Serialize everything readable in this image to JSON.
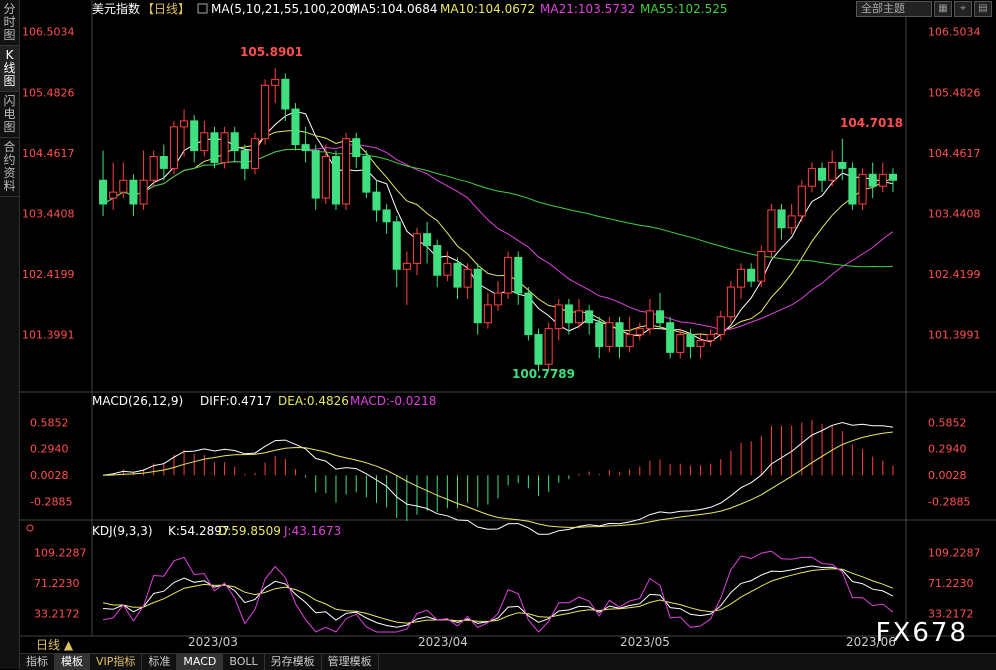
{
  "sidebar": {
    "items": [
      {
        "label": "分时图",
        "active": false
      },
      {
        "label": "K线图",
        "active": true
      },
      {
        "label": "闪电图",
        "active": false
      },
      {
        "label": "合约资料",
        "active": false
      }
    ]
  },
  "header": {
    "symbol": "美元指数",
    "period": "【日线】",
    "ma_title": "MA(5,10,21,55,100,200)",
    "ma5": "MA5:104.0684",
    "ma10": "MA10:104.0672",
    "ma21": "MA21:103.5732",
    "ma55": "MA55:102.525",
    "theme_select": "全部主题"
  },
  "price_axis": {
    "ticks": [
      "106.5034",
      "105.4826",
      "104.4617",
      "103.4408",
      "102.4199",
      "101.3991"
    ],
    "high_label": "105.8901",
    "low_label": "100.7789",
    "recent_high_label": "104.7018"
  },
  "macd": {
    "title": "MACD(26,12,9)",
    "diff": "DIFF:0.4717",
    "dea": "DEA:0.4826",
    "macd": "MACD:-0.0218",
    "ticks": [
      "0.5852",
      "0.2940",
      "0.0028",
      "-0.2885"
    ]
  },
  "kdj": {
    "title": "KDJ(9,3,3)",
    "k": "K:54.2897",
    "d": "D:59.8509",
    "j": "J:43.1673",
    "ticks": [
      "109.2287",
      "71.2230",
      "33.2172"
    ]
  },
  "date_axis": {
    "labels": [
      "2023/03",
      "2023/04",
      "2023/05",
      "2023/06"
    ]
  },
  "period_label": "日线 ▲",
  "watermark": "FX678",
  "bottom_tabs": [
    {
      "label": "指标",
      "active": false,
      "vip": false
    },
    {
      "label": "模板",
      "active": true,
      "vip": false
    },
    {
      "label": "VIP指标",
      "active": false,
      "vip": true
    },
    {
      "label": "标准",
      "active": false,
      "vip": false
    },
    {
      "label": "MACD",
      "active": true,
      "vip": false
    },
    {
      "label": "BOLL",
      "active": false,
      "vip": false
    },
    {
      "label": "另存模板",
      "active": false,
      "vip": false
    },
    {
      "label": "管理模板",
      "active": false,
      "vip": false
    }
  ],
  "colors": {
    "up": "#ff4040",
    "down": "#40e080",
    "ma5": "#ffffff",
    "ma10": "#e8e860",
    "ma21": "#e040e0",
    "ma55": "#40d040",
    "ma100": "#909090",
    "ma200": "#ff3030",
    "axis_text": "#ff5050"
  },
  "chart_data": {
    "type": "candlestick",
    "price_range": [
      100.5,
      106.7
    ],
    "candles": [
      [
        104.0,
        103.6,
        104.5,
        103.4
      ],
      [
        103.7,
        103.8,
        104.3,
        103.5
      ],
      [
        103.8,
        104.0,
        104.3,
        103.7
      ],
      [
        104.0,
        103.6,
        104.1,
        103.4
      ],
      [
        103.6,
        104.0,
        104.5,
        103.5
      ],
      [
        104.0,
        104.4,
        104.5,
        103.9
      ],
      [
        104.4,
        104.2,
        104.6,
        104.0
      ],
      [
        104.2,
        104.9,
        105.0,
        104.1
      ],
      [
        104.9,
        105.0,
        105.2,
        104.4
      ],
      [
        105.0,
        104.5,
        105.1,
        104.3
      ],
      [
        104.5,
        104.8,
        105.0,
        104.4
      ],
      [
        104.8,
        104.3,
        104.9,
        104.2
      ],
      [
        104.3,
        104.8,
        104.9,
        104.2
      ],
      [
        104.8,
        104.5,
        104.9,
        104.3
      ],
      [
        104.5,
        104.2,
        104.6,
        104.0
      ],
      [
        104.2,
        104.7,
        104.8,
        104.1
      ],
      [
        104.7,
        105.6,
        105.7,
        104.6
      ],
      [
        105.6,
        105.7,
        105.89,
        105.3
      ],
      [
        105.7,
        105.2,
        105.8,
        105.0
      ],
      [
        105.2,
        104.6,
        105.3,
        104.5
      ],
      [
        104.6,
        104.5,
        104.9,
        104.3
      ],
      [
        104.5,
        103.7,
        104.6,
        103.5
      ],
      [
        103.7,
        104.4,
        104.6,
        103.6
      ],
      [
        104.4,
        103.6,
        104.5,
        103.5
      ],
      [
        103.6,
        104.7,
        104.8,
        103.5
      ],
      [
        104.7,
        104.4,
        104.8,
        104.2
      ],
      [
        104.4,
        103.8,
        104.5,
        103.7
      ],
      [
        103.8,
        103.5,
        104.0,
        103.3
      ],
      [
        103.5,
        103.3,
        103.6,
        103.1
      ],
      [
        103.3,
        102.5,
        103.4,
        102.2
      ],
      [
        102.5,
        102.6,
        102.8,
        101.9
      ],
      [
        102.6,
        103.1,
        103.2,
        102.4
      ],
      [
        103.1,
        102.9,
        103.3,
        102.6
      ],
      [
        102.9,
        102.4,
        103.0,
        102.2
      ],
      [
        102.4,
        102.6,
        102.8,
        102.3
      ],
      [
        102.6,
        102.2,
        102.7,
        102.0
      ],
      [
        102.2,
        102.5,
        102.6,
        102.0
      ],
      [
        102.5,
        101.6,
        102.6,
        101.4
      ],
      [
        101.6,
        101.9,
        102.1,
        101.5
      ],
      [
        101.9,
        102.1,
        102.3,
        101.8
      ],
      [
        102.1,
        102.7,
        102.8,
        102.0
      ],
      [
        102.7,
        102.1,
        102.8,
        101.9
      ],
      [
        102.1,
        101.4,
        102.2,
        101.3
      ],
      [
        101.4,
        100.9,
        101.5,
        100.78
      ],
      [
        100.9,
        101.5,
        101.6,
        100.8
      ],
      [
        101.5,
        101.9,
        102.0,
        101.3
      ],
      [
        101.9,
        101.6,
        102.0,
        101.4
      ],
      [
        101.6,
        101.8,
        102.0,
        101.5
      ],
      [
        101.8,
        101.6,
        101.9,
        101.4
      ],
      [
        101.6,
        101.2,
        101.7,
        101.0
      ],
      [
        101.2,
        101.6,
        101.7,
        101.1
      ],
      [
        101.6,
        101.2,
        101.7,
        101.0
      ],
      [
        101.2,
        101.4,
        101.7,
        101.1
      ],
      [
        101.4,
        101.5,
        101.6,
        101.3
      ],
      [
        101.5,
        101.8,
        102.0,
        101.4
      ],
      [
        101.8,
        101.6,
        102.1,
        101.5
      ],
      [
        101.6,
        101.1,
        101.7,
        101.0
      ],
      [
        101.1,
        101.4,
        101.5,
        101.0
      ],
      [
        101.4,
        101.2,
        101.5,
        101.0
      ],
      [
        101.2,
        101.3,
        101.4,
        101.0
      ],
      [
        101.3,
        101.4,
        101.5,
        101.2
      ],
      [
        101.4,
        101.7,
        101.8,
        101.3
      ],
      [
        101.7,
        102.2,
        102.3,
        101.6
      ],
      [
        102.2,
        102.5,
        102.6,
        102.0
      ],
      [
        102.5,
        102.3,
        102.6,
        102.2
      ],
      [
        102.3,
        102.8,
        102.9,
        102.2
      ],
      [
        102.8,
        103.5,
        103.6,
        102.7
      ],
      [
        103.5,
        103.2,
        103.6,
        103.0
      ],
      [
        103.2,
        103.4,
        103.6,
        103.1
      ],
      [
        103.4,
        103.9,
        104.0,
        103.3
      ],
      [
        103.9,
        104.2,
        104.3,
        103.8
      ],
      [
        104.2,
        104.0,
        104.3,
        103.8
      ],
      [
        104.0,
        104.3,
        104.5,
        103.9
      ],
      [
        104.3,
        104.2,
        104.7,
        104.0
      ],
      [
        104.2,
        103.6,
        104.3,
        103.5
      ],
      [
        103.6,
        104.1,
        104.2,
        103.5
      ],
      [
        104.1,
        103.9,
        104.3,
        103.7
      ],
      [
        103.9,
        104.1,
        104.3,
        103.8
      ],
      [
        104.1,
        104.0,
        104.2,
        103.8
      ]
    ],
    "macd_range": [
      -0.45,
      0.7
    ],
    "kdj_range": [
      10,
      125
    ]
  }
}
